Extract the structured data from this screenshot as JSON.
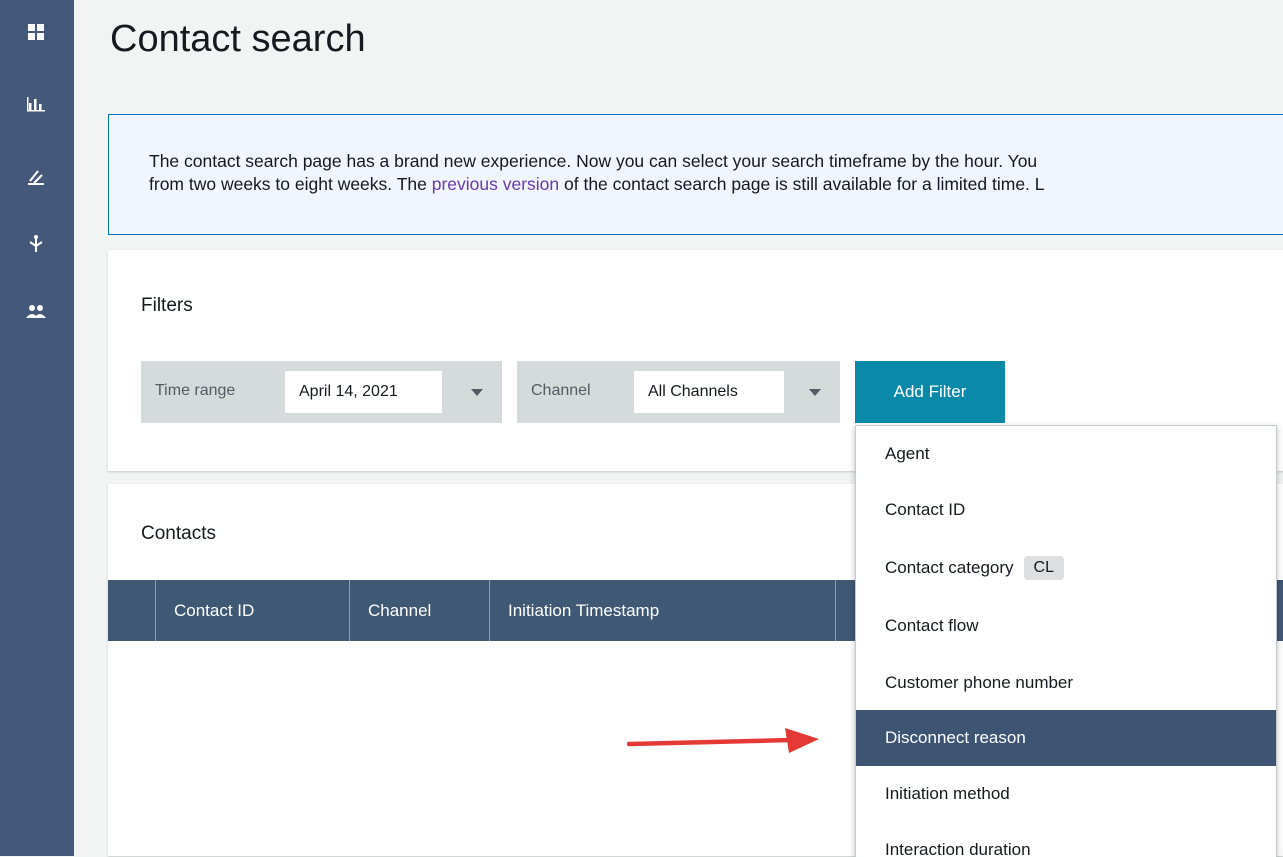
{
  "sidebar": {
    "icons": [
      "dashboard-icon",
      "metrics-icon",
      "routing-icon",
      "flows-icon",
      "users-icon"
    ]
  },
  "page": {
    "title": "Contact search"
  },
  "banner": {
    "text_line1": "The contact search page has a brand new experience. Now you can select your search timeframe by the hour. You",
    "text_line2_before": "from two weeks to eight weeks. The ",
    "link": "previous version",
    "text_line2_after": " of the contact search page is still available for a limited time. L"
  },
  "filters": {
    "heading": "Filters",
    "time_range_label": "Time range",
    "time_range_value": "April 14, 2021",
    "channel_label": "Channel",
    "channel_value": "All Channels",
    "add_filter_label": "Add Filter"
  },
  "contacts": {
    "heading": "Contacts",
    "columns": [
      "Contact ID",
      "Channel",
      "Initiation Timestamp"
    ]
  },
  "add_filter_menu": {
    "items": [
      {
        "label": "Agent"
      },
      {
        "label": "Contact ID"
      },
      {
        "label": "Contact category",
        "badge": "CL"
      },
      {
        "label": "Contact flow"
      },
      {
        "label": "Customer phone number"
      },
      {
        "label": "Disconnect reason",
        "selected": true
      },
      {
        "label": "Initiation method"
      },
      {
        "label": "Interaction duration"
      }
    ]
  },
  "colors": {
    "sidebar": "#44597a",
    "accent_button": "#0a8aa8",
    "table_header": "#3f5874",
    "selected_item": "#3d5573",
    "annotation_arrow": "#e53935",
    "banner_border": "#0073bb"
  }
}
